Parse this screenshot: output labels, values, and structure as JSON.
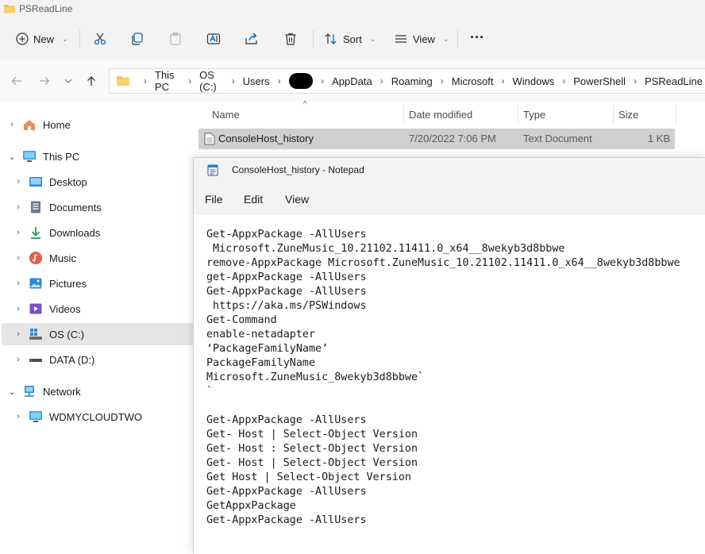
{
  "explorer": {
    "window_title": "PSReadLine",
    "toolbar": {
      "new_label": "New",
      "sort_label": "Sort",
      "view_label": "View",
      "more_label": "···"
    },
    "breadcrumbs": [
      "This PC",
      "OS (C:)",
      "Users",
      "AppData",
      "Roaming",
      "Microsoft",
      "Windows",
      "PowerShell",
      "PSReadLine"
    ],
    "sidebar": {
      "items": [
        {
          "label": "Home"
        },
        {
          "label": "This PC"
        },
        {
          "label": "Desktop"
        },
        {
          "label": "Documents"
        },
        {
          "label": "Downloads"
        },
        {
          "label": "Music"
        },
        {
          "label": "Pictures"
        },
        {
          "label": "Videos"
        },
        {
          "label": "OS (C:)"
        },
        {
          "label": "DATA (D:)"
        },
        {
          "label": "Network"
        },
        {
          "label": "WDMYCLOUDTWO"
        }
      ]
    },
    "columns": {
      "name": "Name",
      "date_modified": "Date modified",
      "type": "Type",
      "size": "Size"
    },
    "files": [
      {
        "name": "ConsoleHost_history",
        "date_modified": "7/20/2022 7:06 PM",
        "type": "Text Document",
        "size": "1 KB"
      }
    ]
  },
  "notepad": {
    "title": "ConsoleHost_history - Notepad",
    "menu": {
      "file": "File",
      "edit": "Edit",
      "view": "View"
    },
    "content": "Get-AppxPackage -AllUsers\n Microsoft.ZuneMusic_10.21102.11411.0_x64__8wekyb3d8bbwe\nremove-AppxPackage Microsoft.ZuneMusic_10.21102.11411.0_x64__8wekyb3d8bbwe\nget-AppxPackage -AllUsers\nGet-AppxPackage -AllUsers\n https://aka.ms/PSWindows\nGet-Command\nenable-netadapter\n‘PackageFamilyName’\nPackageFamilyName\nMicrosoft.ZuneMusic_8wekyb3d8bbwe`\n`\n\nGet-AppxPackage -AllUsers\nGet- Host | Select-Object Version\nGet- Host : Select-Object Version\nGet- Host | Select-Object Version\nGet Host | Select-Object Version\nGet-AppxPackage -AllUsers\nGetAppxPackage\nGet-AppxPackage -AllUsers"
  },
  "colors": {
    "folder": "#f2c14e",
    "accent": "#0067c0",
    "selected_row": "#cfcfcf",
    "chrome": "#f3f3f3"
  }
}
